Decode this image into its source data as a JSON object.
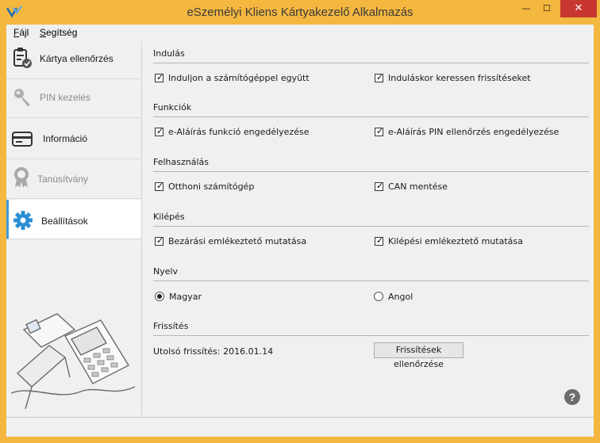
{
  "window": {
    "title": "eSzemélyi Kliens Kártyakezelő Alkalmazás",
    "minimize_glyph": "—",
    "maximize_glyph": "☐",
    "close_glyph": "✕"
  },
  "menu": {
    "items": [
      {
        "mnemonic": "F",
        "rest": "ájl"
      },
      {
        "mnemonic": "S",
        "rest": "egítség"
      }
    ]
  },
  "sidebar": {
    "items": [
      {
        "label": "Kártya ellenőrzés",
        "icon": "card-check-icon",
        "enabled": true,
        "active": false
      },
      {
        "label": "PIN kezelés",
        "icon": "key-icon",
        "enabled": false,
        "active": false
      },
      {
        "label": "Információ",
        "icon": "card-info-icon",
        "enabled": true,
        "active": false
      },
      {
        "label": "Tanúsítvány",
        "icon": "certificate-icon",
        "enabled": false,
        "active": false
      },
      {
        "label": "Beállítások",
        "icon": "gear-icon",
        "enabled": true,
        "active": true
      }
    ]
  },
  "settings": {
    "startup": {
      "title": "Indulás",
      "options": [
        {
          "label": "Induljon a számítógéppel együtt",
          "checked": true
        },
        {
          "label": "Induláskor keressen frissítéseket",
          "checked": true
        }
      ]
    },
    "functions": {
      "title": "Funkciók",
      "options": [
        {
          "label": "e-Aláírás funkció engedélyezése",
          "checked": true
        },
        {
          "label": "e-Aláírás PIN ellenőrzés engedélyezése",
          "checked": true
        }
      ]
    },
    "usage": {
      "title": "Felhasználás",
      "options": [
        {
          "label": "Otthoni számítógép",
          "checked": true
        },
        {
          "label": "CAN mentése",
          "checked": true
        }
      ]
    },
    "exit": {
      "title": "Kilépés",
      "options": [
        {
          "label": "Bezárási emlékeztető mutatása",
          "checked": true
        },
        {
          "label": "Kilépési emlékeztető mutatása",
          "checked": true
        }
      ]
    },
    "language": {
      "title": "Nyelv",
      "options": [
        {
          "label": "Magyar",
          "selected": true
        },
        {
          "label": "Angol",
          "selected": false
        }
      ]
    },
    "updates": {
      "title": "Frissítés",
      "last_update": "Utolsó frissítés: 2016.01.14",
      "button_label": "Frissítések ellenőrzése"
    }
  },
  "help": {
    "glyph": "?"
  },
  "colors": {
    "title_bar": "#f4b740",
    "active_accent": "#3a9ad9",
    "close_button": "#c7372f"
  }
}
